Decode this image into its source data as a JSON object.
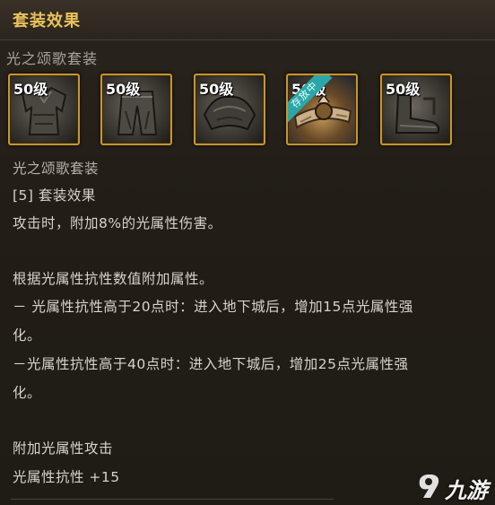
{
  "header": {
    "title": "套装效果"
  },
  "set": {
    "name": "光之颂歌套装"
  },
  "slots": [
    {
      "level": "50级",
      "icon": "coat-armor-icon"
    },
    {
      "level": "50级",
      "icon": "pants-armor-icon"
    },
    {
      "level": "50级",
      "icon": "shoulder-armor-icon"
    },
    {
      "level": "50级",
      "icon": "belt-armor-icon",
      "badge": "存放中"
    },
    {
      "level": "50级",
      "icon": "shoes-armor-icon"
    }
  ],
  "effect": {
    "set_name": "光之颂歌套装",
    "tier_line": "[5] 套装效果",
    "line1": "攻击时，附加8%的光属性伤害。",
    "line2": "根据光属性抗性数值附加属性。",
    "line3a": "－ 光属性抗性高于20点时：进入地下城后，增加15点光属性强",
    "line3b": "化。",
    "line4a": "－光属性抗性高于40点时：进入地下城后，增加25点光属性强",
    "line4b": "化。",
    "line5": "附加光属性攻击",
    "line6": "光属性抗性 +15"
  },
  "watermark": {
    "text": "九游"
  },
  "colors": {
    "gold": "#e9c25a",
    "slot_border": "#c7962f",
    "ribbon": "#2aa7a8",
    "text": "#d8d3c9"
  }
}
